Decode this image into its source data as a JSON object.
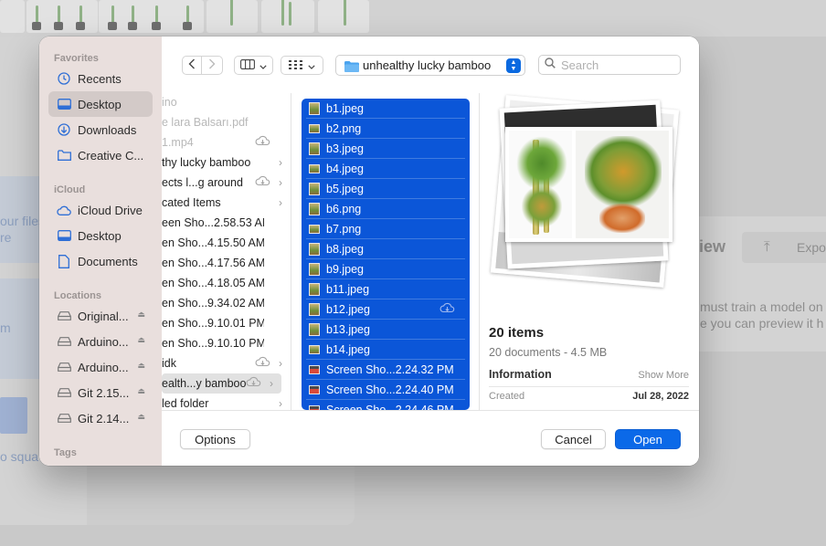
{
  "background": {
    "left_lines": [
      "our files",
      "re",
      "m",
      "o squa"
    ],
    "right_header": "iew",
    "export_label": "Expo",
    "right_lines": [
      "must train a model on",
      "e you can preview it h"
    ]
  },
  "sidebar": {
    "sections": [
      {
        "title": "Favorites",
        "items": [
          {
            "label": "Recents",
            "icon": "clock-icon",
            "selected": false
          },
          {
            "label": "Desktop",
            "icon": "desktop-icon",
            "selected": true
          },
          {
            "label": "Downloads",
            "icon": "download-icon",
            "selected": false
          },
          {
            "label": "Creative C...",
            "icon": "folder-icon",
            "selected": false
          }
        ]
      },
      {
        "title": "iCloud",
        "items": [
          {
            "label": "iCloud Drive",
            "icon": "cloud-icon"
          },
          {
            "label": "Desktop",
            "icon": "desktop-icon"
          },
          {
            "label": "Documents",
            "icon": "document-icon"
          }
        ]
      },
      {
        "title": "Locations",
        "items": [
          {
            "label": "Original...",
            "icon": "drive-icon"
          },
          {
            "label": "Arduino...",
            "icon": "drive-icon"
          },
          {
            "label": "Arduino...",
            "icon": "drive-icon"
          },
          {
            "label": "Git 2.15...",
            "icon": "drive-icon"
          },
          {
            "label": "Git 2.14...",
            "icon": "drive-icon"
          }
        ]
      },
      {
        "title": "Tags",
        "items": []
      }
    ]
  },
  "toolbar": {
    "path": "unhealthy lucky bamboo",
    "search_placeholder": "Search"
  },
  "column1": {
    "items": [
      {
        "name": "ino",
        "dim": true
      },
      {
        "name": "e lara Balsarı.pdf",
        "dim": true
      },
      {
        "name": "1.mp4",
        "dim": true,
        "cloud": true
      },
      {
        "name": "thy lucky bamboo",
        "chevron": true
      },
      {
        "name": "ects l...g around",
        "cloud": true,
        "chevron": true
      },
      {
        "name": "cated Items",
        "chevron": true
      },
      {
        "name": "een Sho...2.58.53 AM"
      },
      {
        "name": "en Sho...4.15.50 AM"
      },
      {
        "name": "en Sho...4.17.56 AM"
      },
      {
        "name": "en Sho...4.18.05 AM"
      },
      {
        "name": "en Sho...9.34.02 AM"
      },
      {
        "name": "en Sho...9.10.01 PM"
      },
      {
        "name": "en Sho...9.10.10 PM"
      },
      {
        "name": " idk",
        "cloud": true,
        "chevron": true
      },
      {
        "name": "ealth...y bamboo",
        "selected": true,
        "cloud": true,
        "chevron": true
      },
      {
        "name": "led folder",
        "chevron": true
      }
    ]
  },
  "column2": {
    "items": [
      {
        "name": "b1.jpeg"
      },
      {
        "name": "b2.png",
        "wide": true
      },
      {
        "name": "b3.jpeg"
      },
      {
        "name": "b4.jpeg",
        "wide": true
      },
      {
        "name": "b5.jpeg"
      },
      {
        "name": "b6.png"
      },
      {
        "name": "b7.png",
        "wide": true
      },
      {
        "name": "b8.jpeg"
      },
      {
        "name": "b9.jpeg"
      },
      {
        "name": "b11.jpeg"
      },
      {
        "name": "b12.jpeg",
        "cloud": true
      },
      {
        "name": "b13.jpeg"
      },
      {
        "name": "b14.jpeg",
        "wide": true
      },
      {
        "name": "Screen Sho...2.24.32 PM",
        "wide": true,
        "red": true
      },
      {
        "name": "Screen Sho...2.24.40 PM",
        "wide": true,
        "red": true
      },
      {
        "name": "Screen Sho...2.24.46 PM",
        "wide": true,
        "red": true
      }
    ]
  },
  "preview": {
    "title": "20 items",
    "subtitle": "20 documents - 4.5 MB",
    "info_heading": "Information",
    "show_more": "Show More",
    "created_label": "Created",
    "created_value": "Jul 28, 2022"
  },
  "footer": {
    "options": "Options",
    "cancel": "Cancel",
    "open": "Open"
  },
  "colors": {
    "accent": "#0b69e8",
    "selection": "#0b56d8",
    "sidebar_bg": "#e9dfdd"
  }
}
